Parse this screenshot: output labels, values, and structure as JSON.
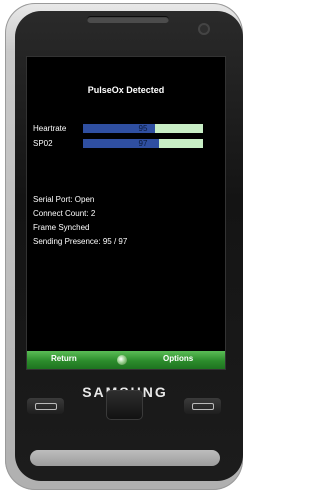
{
  "screen": {
    "title": "PulseOx Detected",
    "metrics": [
      {
        "label": "Heartrate",
        "value": "95",
        "fill_fraction": 0.6
      },
      {
        "label": "SP02",
        "value": "97",
        "fill_fraction": 0.63
      }
    ],
    "status": {
      "serial": "Serial Port: Open",
      "connect": "Connect Count: 2",
      "frame": "Frame Synched",
      "presence": "Sending Presence: 95 / 97"
    }
  },
  "softkeys": {
    "left": "Return",
    "right": "Options"
  },
  "device": {
    "brand": "SAMSUNG"
  },
  "colors": {
    "bar_fill": "#2f4fa1",
    "bar_track": "#c8eec5",
    "softkey_green": "#2c8c2c"
  }
}
